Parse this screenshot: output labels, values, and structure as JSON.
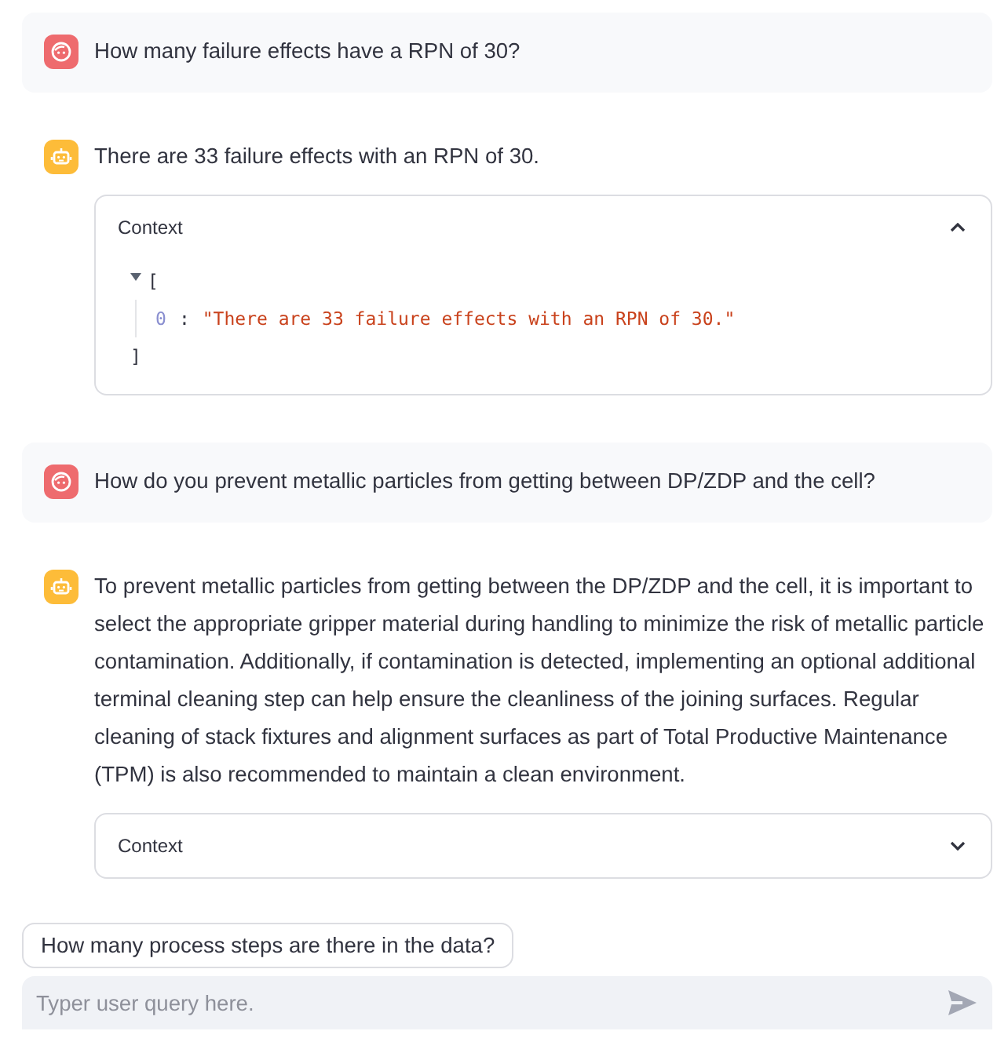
{
  "messages": [
    {
      "kind": "user",
      "text": "How many failure effects have a RPN of 30?"
    },
    {
      "kind": "assistant",
      "text": "There are 33 failure effects with an RPN of 30.",
      "context": {
        "label": "Context",
        "expanded": true,
        "open_bracket": "[",
        "close_bracket": "]",
        "items": [
          {
            "index": "0",
            "separator": ":",
            "value": "\"There are 33 failure effects with an RPN of 30.\""
          }
        ]
      }
    },
    {
      "kind": "user",
      "text": "How do you prevent metallic particles from getting between DP/ZDP and the cell?"
    },
    {
      "kind": "assistant",
      "text": "To prevent metallic particles from getting between the DP/ZDP and the cell, it is important to select the appropriate gripper material during handling to minimize the risk of metallic particle contamination. Additionally, if contamination is detected, implementing an optional additional terminal cleaning step can help ensure the cleanliness of the joining surfaces. Regular cleaning of stack fixtures and alignment surfaces as part of Total Productive Maintenance (TPM) is also recommended to maintain a clean environment.",
      "context": {
        "label": "Context",
        "expanded": false
      }
    }
  ],
  "suggestion": "How many process steps are there in the data?",
  "chat_input": {
    "placeholder": "Typer user query here."
  }
}
